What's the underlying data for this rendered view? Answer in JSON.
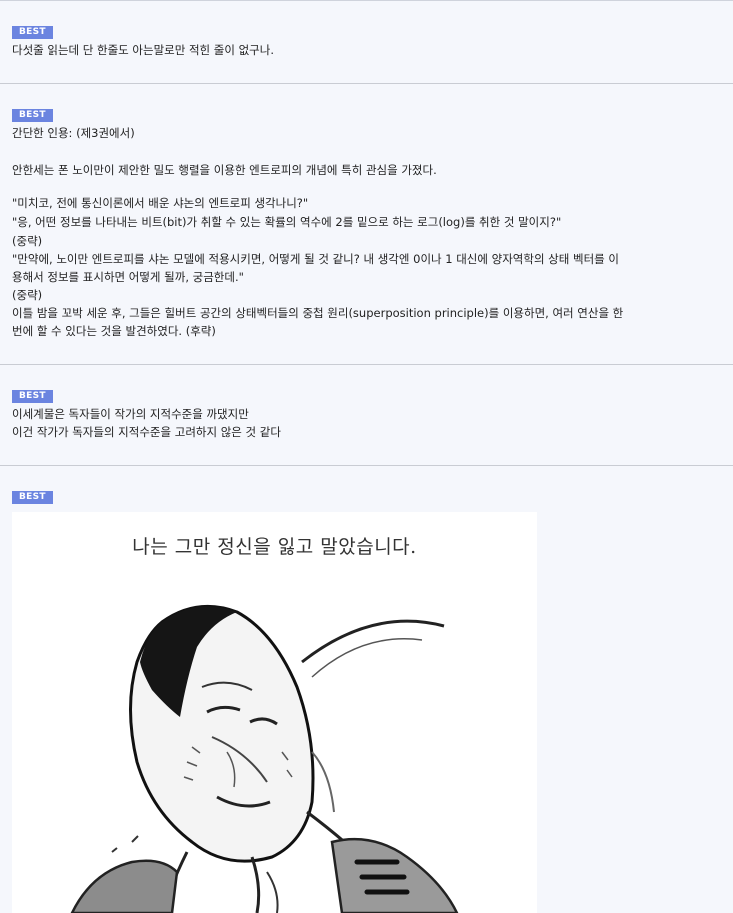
{
  "comments": [
    {
      "badge": "BEST",
      "lines": [
        "다섯줄 읽는데 단 한줄도 아는말로만 적힌 줄이 없구나."
      ]
    },
    {
      "badge": "BEST",
      "lines": [
        "간단한 인용: (제3권에서)",
        "",
        "안한세는 폰 노이만이 제안한 밀도 행렬을 이용한 엔트로피의 개념에 특히 관심을 가졌다.",
        "",
        "\"미치코, 전에 통신이론에서 배운 샤논의 엔트로피 생각나니?\"",
        "\"응, 어떤 정보를 나타내는 비트(bit)가 취할 수 있는 확률의 역수에 2를 밑으로 하는 로그(log)를 취한 것 말이지?\"",
        "(중략)",
        "\"만약에, 노이만 엔트로피를 샤논 모델에 적용시키면, 어떻게 될 것 같니? 내 생각엔 0이나 1 대신에 양자역학의 상태 벡터를 이",
        "용해서 정보를 표시하면 어떻게 될까, 궁금한데.\"",
        "(중략)",
        "이틀 밤을 꼬박 세운 후, 그들은 힐버트 공간의 상태벡터들의 중첩 원리(superposition principle)를 이용하면, 여러 연산을 한",
        "번에 할 수 있다는 것을 발견하였다. (후략)"
      ]
    },
    {
      "badge": "BEST",
      "lines": [
        "이세계물은 독자들이 작가의 지적수준을 까댔지만",
        "이건 작가가 독자들의 지적수준을 고려하지 않은 것 같다"
      ]
    },
    {
      "badge": "BEST",
      "image_caption": "나는 그만 정신을 잃고 말았습니다."
    }
  ]
}
